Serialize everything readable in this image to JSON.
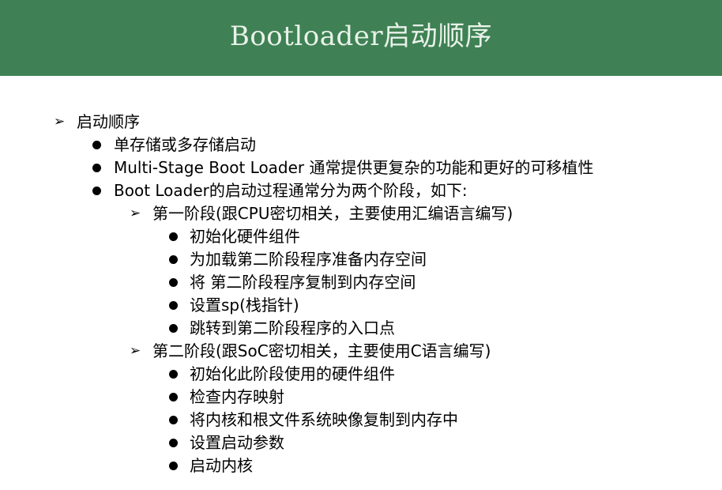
{
  "slide": {
    "title": "Bootloader启动顺序",
    "colors": {
      "title_bar": "#3f8154",
      "title_text": "#e9f2ea",
      "body_text": "#000000"
    },
    "bullet_icons": {
      "level1": "arrow-bullet-icon",
      "level2": "dot-bullet-icon",
      "level3": "arrow-bullet-icon",
      "level4": "dot-bullet-icon"
    },
    "items": [
      {
        "text": "启动顺序"
      },
      {
        "text": "单存储或多存储启动"
      },
      {
        "text": "Multi-Stage Boot Loader 通常提供更复杂的功能和更好的可移植性"
      },
      {
        "text": "Boot Loader的启动过程通常分为两个阶段，如下:"
      },
      {
        "text": "第一阶段(跟CPU密切相关，主要使用汇编语言编写)"
      },
      {
        "text": "初始化硬件组件"
      },
      {
        "text": "为加载第二阶段程序准备内存空间"
      },
      {
        "text": "将 第二阶段程序复制到内存空间"
      },
      {
        "text": "设置sp(栈指针)"
      },
      {
        "text": "跳转到第二阶段程序的入口点"
      },
      {
        "text": "第二阶段(跟SoC密切相关，主要使用C语言编写)"
      },
      {
        "text": "初始化此阶段使用的硬件组件"
      },
      {
        "text": "检查内存映射"
      },
      {
        "text": "将内核和根文件系统映像复制到内存中"
      },
      {
        "text": "设置启动参数"
      },
      {
        "text": "启动内核"
      }
    ]
  }
}
